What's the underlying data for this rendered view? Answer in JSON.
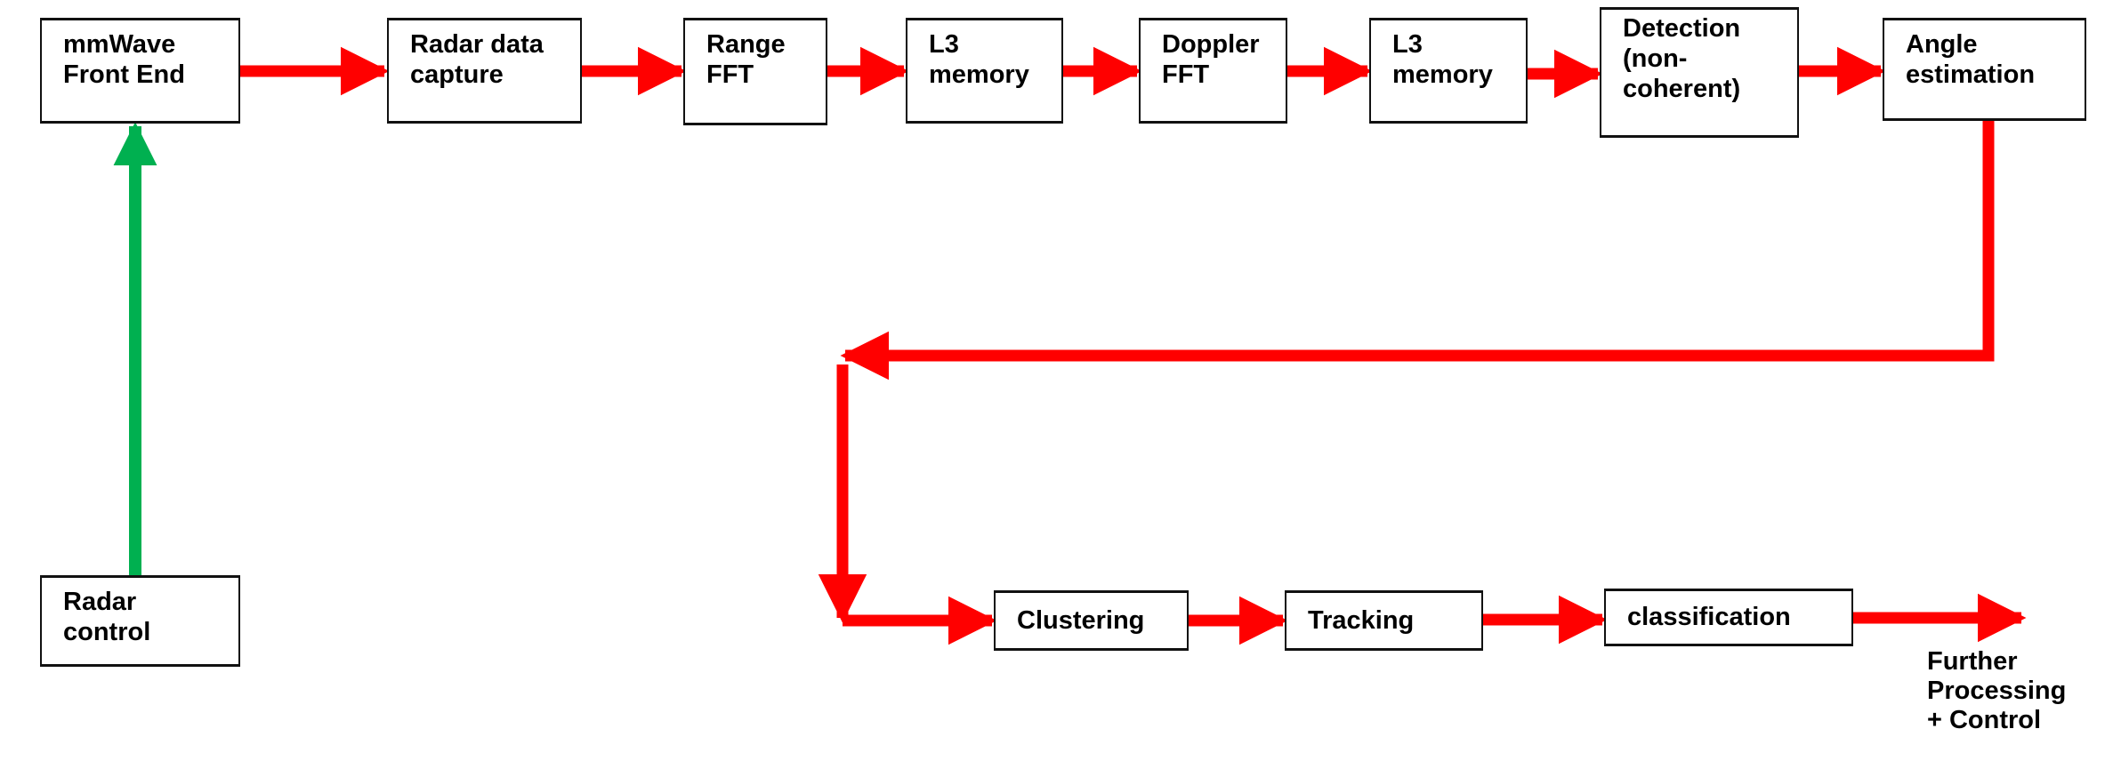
{
  "colors": {
    "flow_arrow": "#ff0000",
    "control_arrow": "#00b050",
    "box_border": "#111111"
  },
  "blocks": {
    "front_end": "mmWave\nFront End",
    "data_capture": "Radar data\ncapture",
    "range_fft": "Range\nFFT",
    "l3_memory_1": "L3\nmemory",
    "doppler_fft": "Doppler\nFFT",
    "l3_memory_2": "L3\nmemory",
    "detection": "Detection\n(non-\ncoherent)",
    "angle_estimation": "Angle\nestimation",
    "radar_control": "Radar\ncontrol",
    "clustering": "Clustering",
    "tracking": "Tracking",
    "classification": "classification"
  },
  "output_label": "Further\nProcessing\n+ Control"
}
